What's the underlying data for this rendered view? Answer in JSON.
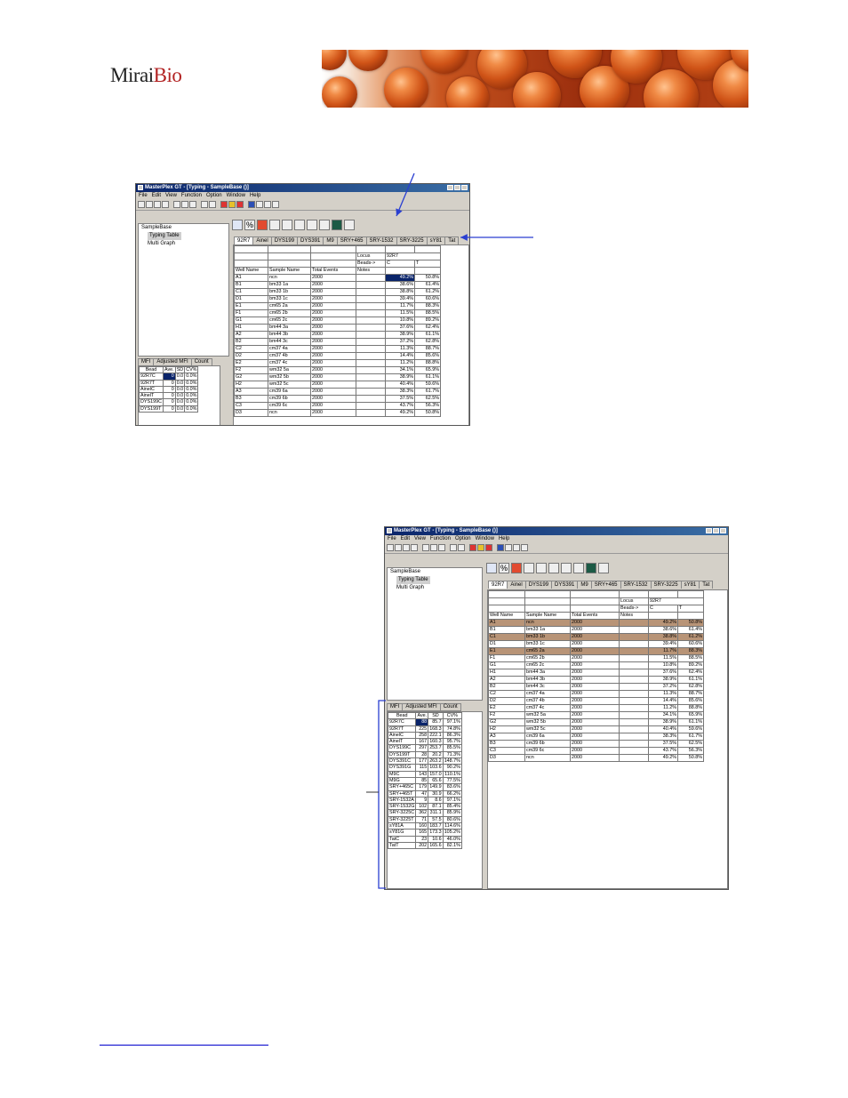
{
  "logo": {
    "part1": "Mirai",
    "part2": "Bio"
  },
  "app": {
    "title": "MasterPlex GT - [Typing - SampleBase ()]",
    "menus": [
      "File",
      "Edit",
      "View",
      "Function",
      "Option",
      "Window",
      "Help"
    ],
    "tree": [
      "SampleBase",
      "Typing Table",
      "Multi Graph"
    ],
    "bead_tabs": [
      "MFI",
      "Adjusted MFI",
      "Count"
    ],
    "locus_tabs": [
      "92R7",
      "Ainel",
      "DYS199",
      "DYS391",
      "M9",
      "SRY+465",
      "SRY-1532",
      "SRY-3225",
      "sY81",
      "Tat"
    ],
    "pct_label": "%"
  },
  "typing_table": {
    "header_rows": [
      [
        "Locus",
        "92R7"
      ],
      [
        "Beads->",
        "C",
        "T"
      ]
    ],
    "columns": [
      "Well Name",
      "Sample Name",
      "Total Events",
      "Notes"
    ],
    "rows": [
      [
        "A1",
        "ncn",
        "2000",
        "",
        "49.2%",
        "50.8%"
      ],
      [
        "B1",
        "bm33 1a",
        "2000",
        "",
        "38.6%",
        "61.4%"
      ],
      [
        "C1",
        "bm33 1b",
        "2000",
        "",
        "38.8%",
        "61.2%"
      ],
      [
        "D1",
        "bm33 1c",
        "2000",
        "",
        "39.4%",
        "60.6%"
      ],
      [
        "E1",
        "cm65 2a",
        "2000",
        "",
        "11.7%",
        "88.3%"
      ],
      [
        "F1",
        "cm65 2b",
        "2000",
        "",
        "11.5%",
        "88.5%"
      ],
      [
        "G1",
        "cm65 2c",
        "2000",
        "",
        "10.8%",
        "89.2%"
      ],
      [
        "H1",
        "bm44 3a",
        "2000",
        "",
        "37.6%",
        "62.4%"
      ],
      [
        "A2",
        "bm44 3b",
        "2000",
        "",
        "38.9%",
        "61.1%"
      ],
      [
        "B2",
        "bm44 3c",
        "2000",
        "",
        "37.2%",
        "62.8%"
      ],
      [
        "C2",
        "cm37 4a",
        "2000",
        "",
        "11.3%",
        "88.7%"
      ],
      [
        "D2",
        "cm37 4b",
        "2000",
        "",
        "14.4%",
        "85.6%"
      ],
      [
        "E2",
        "cm37 4c",
        "2000",
        "",
        "11.2%",
        "88.8%"
      ],
      [
        "F2",
        "wm32 5a",
        "2000",
        "",
        "34.1%",
        "65.9%"
      ],
      [
        "G2",
        "wm32 5b",
        "2000",
        "",
        "38.9%",
        "61.1%"
      ],
      [
        "H2",
        "wm32 5c",
        "2000",
        "",
        "40.4%",
        "59.6%"
      ],
      [
        "A3",
        "cm39 6a",
        "2000",
        "",
        "38.3%",
        "61.7%"
      ],
      [
        "B3",
        "cm39 6b",
        "2000",
        "",
        "37.5%",
        "62.5%"
      ],
      [
        "C3",
        "cm39 6c",
        "2000",
        "",
        "43.7%",
        "56.3%"
      ],
      [
        "D3",
        "ncn",
        "2000",
        "",
        "49.2%",
        "50.8%"
      ]
    ]
  },
  "bead_table_1": {
    "columns": [
      "Bead",
      "Ave.",
      "SD",
      "CV%"
    ],
    "rows": [
      [
        "92R7C",
        "0",
        "0.0",
        "0.0%"
      ],
      [
        "92R7T",
        "0",
        "0.0",
        "0.0%"
      ],
      [
        "AinelC",
        "0",
        "0.0",
        "0.0%"
      ],
      [
        "AinelT",
        "0",
        "0.0",
        "0.0%"
      ],
      [
        "DYS199C",
        "0",
        "0.0",
        "0.0%"
      ],
      [
        "DYS199T",
        "0",
        "0.0",
        "0.0%"
      ]
    ]
  },
  "bead_table_2": {
    "columns": [
      "Bead",
      "Ave.",
      "SD",
      "CV%"
    ],
    "rows": [
      [
        "92R7C",
        "88",
        "85.7",
        "97.1%"
      ],
      [
        "92R7T",
        "225",
        "168.3",
        "74.8%"
      ],
      [
        "AinelC",
        "258",
        "222.1",
        "86.3%"
      ],
      [
        "AinelT",
        "167",
        "160.3",
        "95.7%"
      ],
      [
        "DYS199C",
        "297",
        "253.7",
        "85.5%"
      ],
      [
        "DYS199T",
        "28",
        "20.2",
        "71.3%"
      ],
      [
        "DYS391C",
        "177",
        "263.2",
        "148.7%"
      ],
      [
        "DYS391G",
        "115",
        "103.6",
        "90.2%"
      ],
      [
        "M9C",
        "143",
        "157.0",
        "110.1%"
      ],
      [
        "M9G",
        "85",
        "65.6",
        "77.5%"
      ],
      [
        "SRY+465C",
        "179",
        "149.9",
        "83.6%"
      ],
      [
        "SRY+465T",
        "47",
        "30.9",
        "66.2%"
      ],
      [
        "SRY-1532A",
        "9",
        "8.6",
        "97.1%"
      ],
      [
        "SRY-1532G",
        "102",
        "87.1",
        "85.4%"
      ],
      [
        "SRY-3225C",
        "362",
        "311.1",
        "85.9%"
      ],
      [
        "SRY-3225T",
        "71",
        "57.5",
        "80.6%"
      ],
      [
        "sY81A",
        "160",
        "183.7",
        "114.6%"
      ],
      [
        "sY81G",
        "165",
        "173.3",
        "105.2%"
      ],
      [
        "TatC",
        "23",
        "10.6",
        "46.0%"
      ],
      [
        "TatT",
        "202",
        "165.6",
        "82.1%"
      ]
    ]
  },
  "colors": {
    "arrow": "#2a3fd1",
    "selection": "#0a246a",
    "row_highlight": "#b89477",
    "footer_line": "#0000cc"
  }
}
